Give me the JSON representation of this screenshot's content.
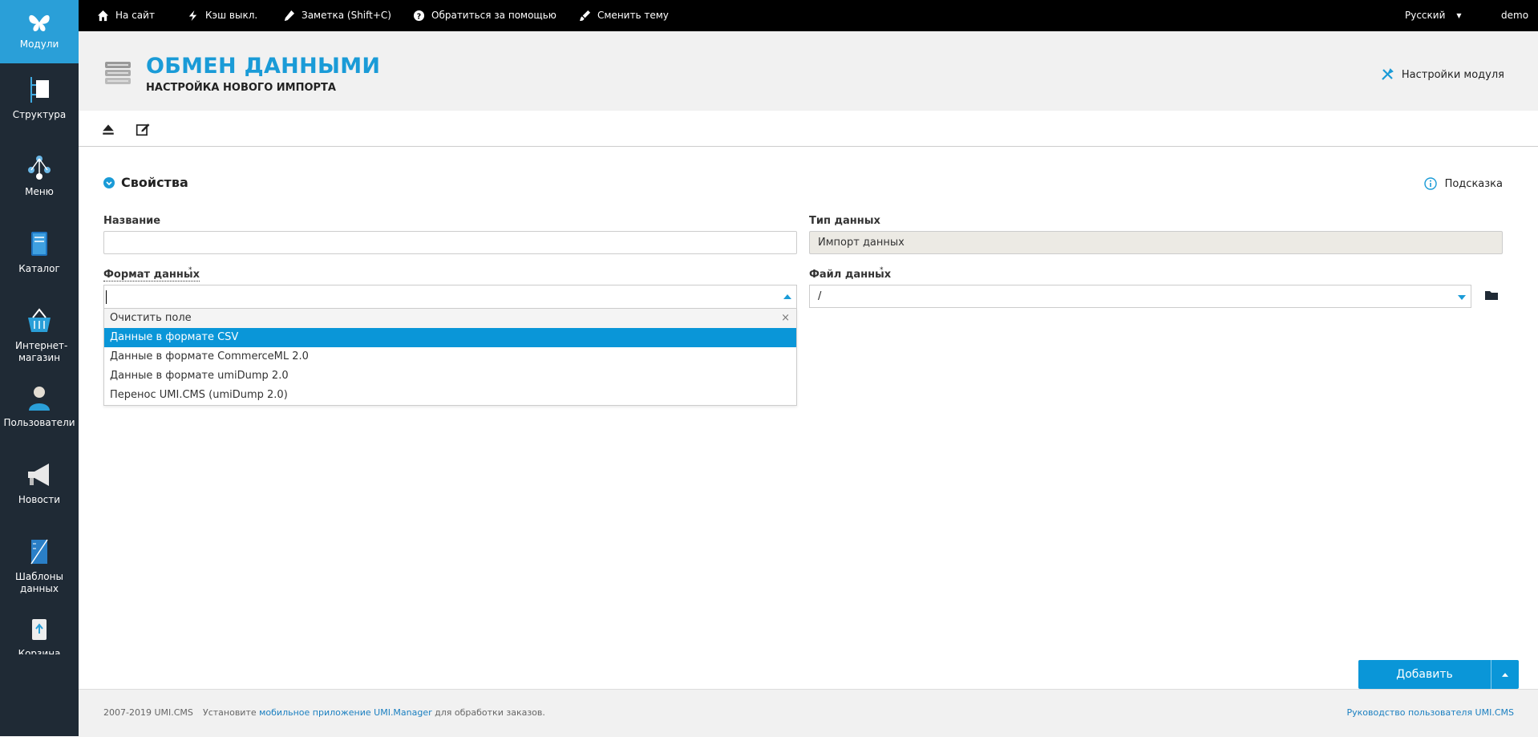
{
  "sidebar": {
    "items": [
      {
        "label": "Модули",
        "icon": "butterfly-icon"
      },
      {
        "label": "Структура",
        "icon": "structure-icon"
      },
      {
        "label": "Меню",
        "icon": "menu-tree-icon"
      },
      {
        "label": "Каталог",
        "icon": "catalog-book-icon"
      },
      {
        "label": "Интернет-магазин",
        "icon": "shopping-basket-icon"
      },
      {
        "label": "Пользователи",
        "icon": "user-icon"
      },
      {
        "label": "Новости",
        "icon": "megaphone-icon"
      },
      {
        "label": "Шаблоны данных",
        "icon": "ruler-icon"
      },
      {
        "label": "Корзина",
        "icon": "recycle-bin-icon"
      }
    ]
  },
  "topbar": {
    "site": "На сайт",
    "cache": "Кэш выкл.",
    "note": "Заметка (Shift+C)",
    "help": "Обратиться за помощью",
    "theme": "Сменить тему",
    "language": "Русский",
    "user": "demo"
  },
  "header": {
    "title": "ОБМЕН ДАННЫМИ",
    "subtitle": "НАСТРОЙКА НОВОГО ИМПОРТА",
    "module_settings": "Настройки модуля"
  },
  "section": {
    "title": "Свойства",
    "hint": "Подсказка"
  },
  "form": {
    "name_label": "Название",
    "name_value": "",
    "type_label": "Тип данных",
    "type_value": "Импорт данных",
    "format_label": "Формат данных",
    "format_required": "*",
    "file_label": "Файл данных",
    "file_required": "*",
    "file_value": "/",
    "format_options": {
      "clear": "Очистить поле",
      "clear_x": "×",
      "csv": "Данные в формате CSV",
      "commerceml": "Данные в формате CommerceML 2.0",
      "umidump": "Данные в формате umiDump 2.0",
      "transfer": "Перенос UMI.CMS (umiDump 2.0)"
    }
  },
  "actions": {
    "add": "Добавить"
  },
  "footer": {
    "copyright": "2007-2019 UMI.CMS",
    "install_prefix": "Установите ",
    "app_link": "мобильное приложение UMI.Manager",
    "install_suffix": " для обработки заказов.",
    "manual": "Руководство пользователя UMI.CMS"
  },
  "colors": {
    "accent": "#1a9bd7",
    "sidebar_bg": "#1f2a35",
    "topbar_bg": "#000000"
  }
}
